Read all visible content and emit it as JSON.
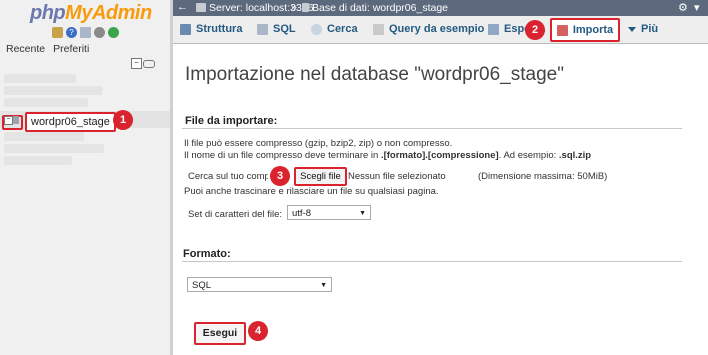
{
  "nav": {
    "logo": {
      "php": "php",
      "my": "My",
      "admin": "Admin"
    },
    "tabs": [
      "Recente",
      "Preferiti"
    ],
    "collapse_symbol": "−",
    "db_item": {
      "expander": "−",
      "label": "wordpr06_stage"
    }
  },
  "breadcrumb": {
    "back": "←",
    "server": "Server: localhost:3306",
    "separator": "»",
    "database": "Base di dati: wordpr06_stage"
  },
  "tabs": {
    "struttura": "Struttura",
    "sql": "SQL",
    "cerca": "Cerca",
    "query": "Query da esempio",
    "esporta": "Esporta",
    "importa": "Importa",
    "piu": "Più"
  },
  "main": {
    "title": "Importazione nel database \"wordpr06_stage\"",
    "file_section": {
      "heading": "File da importare:",
      "line1": "Il file può essere compresso (gzip, bzip2, zip) o non compresso.",
      "line2_prefix": "Il nome di un file compresso deve terminare in ",
      "line2_bold": ".[formato].[compressione]",
      "line2_mid": ". Ad esempio: ",
      "line2_example": ".sql.zip",
      "browse_label": "Cerca sul tuo computer:",
      "choose_button": "Scegli file",
      "no_file": "Nessun file selezionato",
      "max_size": "(Dimensione massima: 50MiB)",
      "drag_hint": "Puoi anche trascinare e rilasciare un file su qualsiasi pagina.",
      "charset_label": "Set di caratteri del file:",
      "charset_value": "utf-8"
    },
    "format_section": {
      "heading": "Formato:",
      "format_value": "SQL"
    },
    "go_button": "Esegui"
  },
  "badges": [
    "1",
    "2",
    "3",
    "4"
  ],
  "colors": {
    "highlight_red": "#d9232e",
    "link_blue": "#235a81",
    "topbar": "#5d6a7d"
  },
  "icons": {
    "home": "home-icon",
    "help": "help-icon",
    "docs": "docs-icon",
    "settings": "gear-icon",
    "reload": "reload-icon"
  }
}
